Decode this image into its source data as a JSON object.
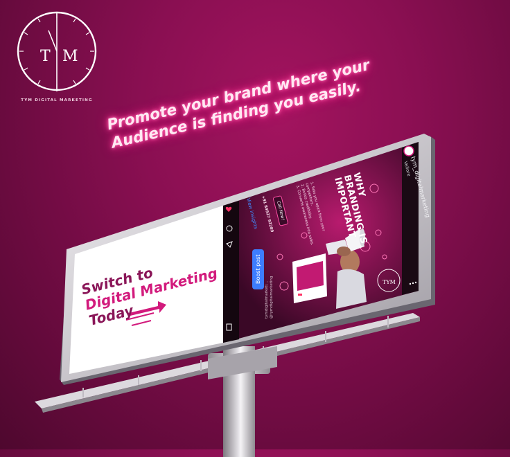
{
  "logo": {
    "mark_left": "T",
    "mark_right": "M",
    "caption": "TYM DIGITAL MARKETING"
  },
  "headline": {
    "line1": "Promote your brand where your",
    "line2": "Audience is finding you easily."
  },
  "billboard_left": {
    "line1": "Switch to",
    "line2": "Digital Marketing",
    "line3": "Today"
  },
  "billboard_right": {
    "username": "tym_digitalmarketing",
    "location": "Vellore",
    "title_line1": "WHY",
    "title_line2": "BRANDING IS",
    "title_line3": "IMPORTANT",
    "point1": "1. Sets you apart from your",
    "point1b": "competitors.",
    "point2": "2. Builds credibility.",
    "point3": "3. Converts awareness into sales.",
    "call_label": "Call Now!",
    "phone": "+91 84937 93289",
    "insights_label": "View insights",
    "boost_label": "Boost post",
    "handle_line1": "tymdigitalmarketi...",
    "handle_line2": "@tymdigitalmarketing"
  },
  "colors": {
    "brand_magenta": "#a3145f",
    "text_deep": "#8a1658",
    "text_bright": "#d21a7c",
    "neon_glow": "#ff3d99",
    "boost_blue": "#3d7dff"
  }
}
